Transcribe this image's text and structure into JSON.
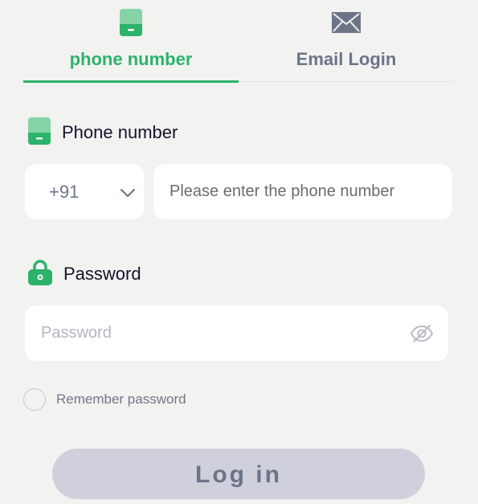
{
  "tabs": [
    {
      "label": "phone number",
      "icon": "phone-icon",
      "active": true
    },
    {
      "label": "Email Login",
      "icon": "envelope-icon",
      "active": false
    }
  ],
  "phone": {
    "label": "Phone number",
    "icon": "phone-icon",
    "country_code": "+91",
    "placeholder": "Please enter the phone number",
    "value": ""
  },
  "password": {
    "label": "Password",
    "icon": "lock-icon",
    "placeholder": "Password",
    "value": "",
    "visibility_icon": "eye-off-icon"
  },
  "remember": {
    "label": "Remember password",
    "checked": false
  },
  "login_button": {
    "label": "Log in"
  },
  "colors": {
    "accent": "#2bb36a",
    "accent_light": "#86d3a6",
    "muted_text": "#6c7488",
    "background": "#f2f2f0",
    "button_disabled": "#cfd0dc"
  }
}
